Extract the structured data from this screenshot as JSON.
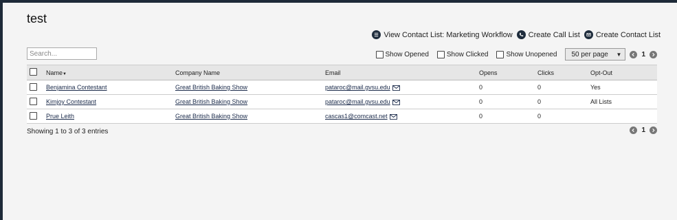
{
  "page": {
    "title": "test"
  },
  "actions": [
    {
      "label": "View Contact List: Marketing Workflow",
      "icon": "list-icon"
    },
    {
      "label": "Create Call List",
      "icon": "phone-icon"
    },
    {
      "label": "Create Contact List",
      "icon": "envelope-icon"
    }
  ],
  "search": {
    "placeholder": "Search...",
    "value": ""
  },
  "filters": {
    "show_opened": "Show Opened",
    "show_clicked": "Show Clicked",
    "show_unopened": "Show Unopened"
  },
  "per_page": {
    "selected": "50 per page"
  },
  "pager": {
    "page": "1"
  },
  "table": {
    "headers": {
      "name": "Name",
      "company": "Company Name",
      "email": "Email",
      "opens": "Opens",
      "clicks": "Clicks",
      "optout": "Opt-Out"
    },
    "rows": [
      {
        "name": "Benjamina Contestant",
        "company": "Great British Baking Show",
        "email": "pataroc@mail.gvsu.edu",
        "opens": "0",
        "clicks": "0",
        "optout": "Yes"
      },
      {
        "name": "Kimjoy Contestant",
        "company": "Great British Baking Show",
        "email": "pataroc@mail.gvsu.edu",
        "opens": "0",
        "clicks": "0",
        "optout": "All Lists"
      },
      {
        "name": "Prue Leith",
        "company": "Great British Baking Show",
        "email": "cascas1@comcast.net",
        "opens": "0",
        "clicks": "0",
        "optout": ""
      }
    ]
  },
  "footer": {
    "showing": "Showing 1 to 3 of 3 entries"
  },
  "colors": {
    "topbar": "#1e2a38",
    "page_bg": "#f4f4f4",
    "header_bg": "#e6e6e6",
    "link": "#1a2a4a"
  }
}
